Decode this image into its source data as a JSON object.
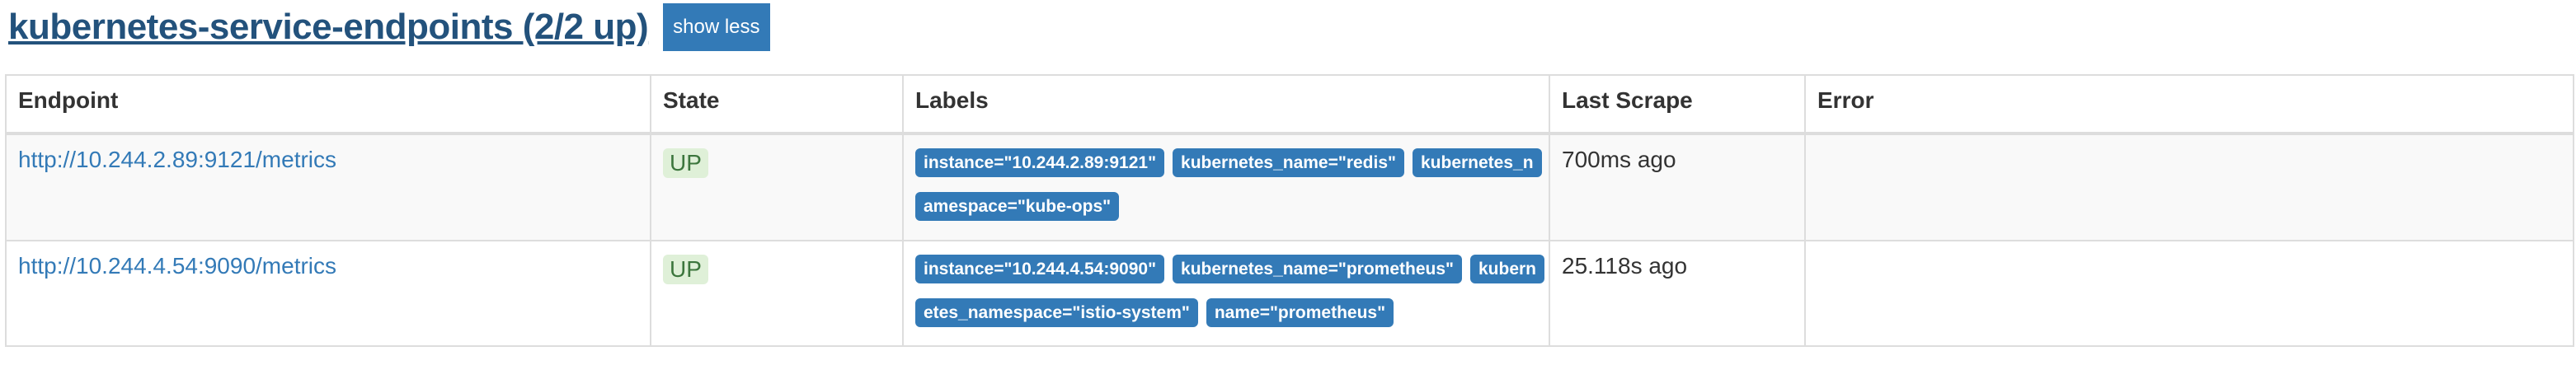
{
  "header": {
    "title": "kubernetes-service-endpoints (2/2 up)",
    "toggle_label": "show less"
  },
  "table": {
    "columns": [
      "Endpoint",
      "State",
      "Labels",
      "Last Scrape",
      "Error"
    ],
    "rows": [
      {
        "endpoint": "http://10.244.2.89:9121/metrics",
        "state": "UP",
        "labels": [
          "instance=\"10.244.2.89:9121\"",
          "kubernetes_name=\"redis\"",
          "kubernetes_namespace=\"kube-ops\""
        ],
        "last_scrape": "700ms ago",
        "error": ""
      },
      {
        "endpoint": "http://10.244.4.54:9090/metrics",
        "state": "UP",
        "labels": [
          "instance=\"10.244.4.54:9090\"",
          "kubernetes_name=\"prometheus\"",
          "kubernetes_namespace=\"istio-system\"",
          "name=\"prometheus\""
        ],
        "last_scrape": "25.118s ago",
        "error": ""
      }
    ]
  },
  "colors": {
    "accent": "#337ab7",
    "up_bg": "#dff0d8",
    "up_text": "#3c763d"
  }
}
